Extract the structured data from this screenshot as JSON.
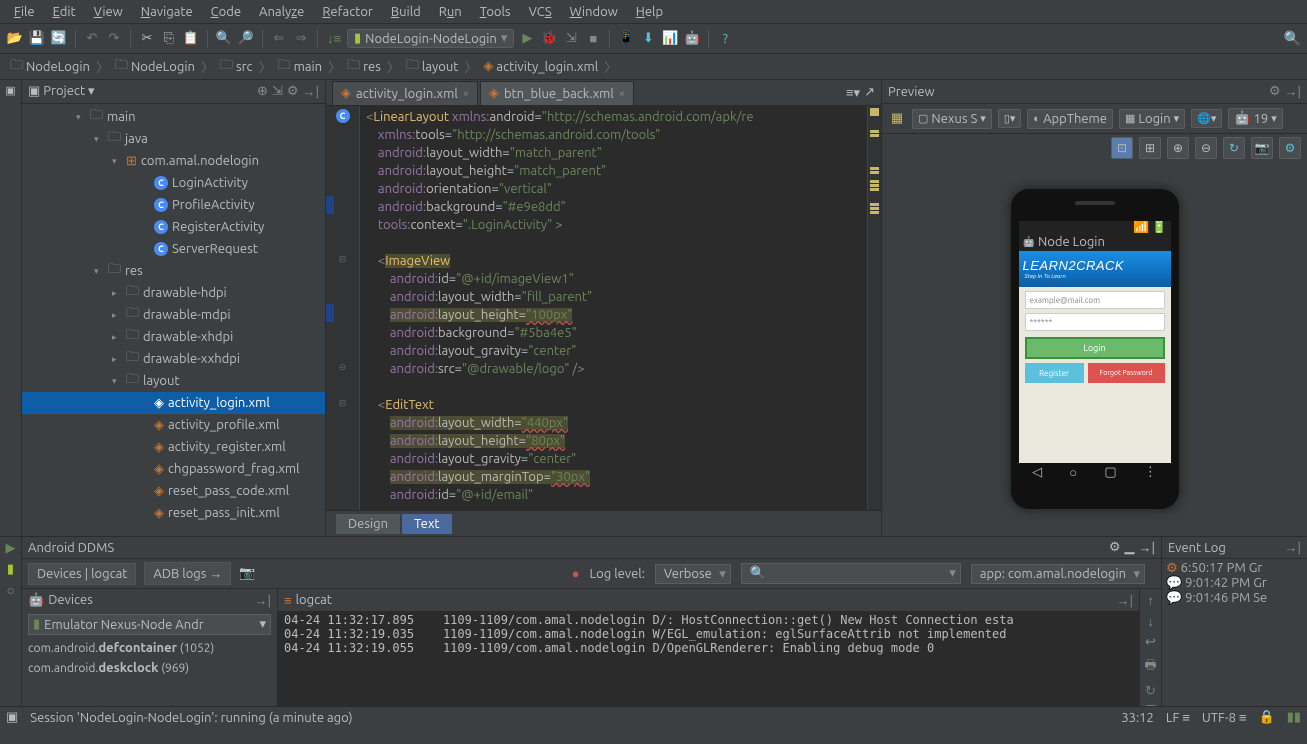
{
  "menu": [
    "File",
    "Edit",
    "View",
    "Navigate",
    "Code",
    "Analyze",
    "Refactor",
    "Build",
    "Run",
    "Tools",
    "VCS",
    "Window",
    "Help"
  ],
  "runConfig": "NodeLogin-NodeLogin",
  "breadcrumb": [
    {
      "icon": "folder",
      "label": "NodeLogin"
    },
    {
      "icon": "folder",
      "label": "NodeLogin"
    },
    {
      "icon": "folder",
      "label": "src"
    },
    {
      "icon": "folder",
      "label": "main"
    },
    {
      "icon": "folder",
      "label": "res"
    },
    {
      "icon": "folder",
      "label": "layout"
    },
    {
      "icon": "xml",
      "label": "activity_login.xml"
    }
  ],
  "projectPanel": {
    "title": "Project"
  },
  "tree": [
    {
      "ind": 54,
      "arrow": "▾",
      "icon": "folder",
      "label": "main"
    },
    {
      "ind": 72,
      "arrow": "▾",
      "icon": "folder",
      "label": "java"
    },
    {
      "ind": 90,
      "arrow": "▾",
      "icon": "pkg",
      "label": "com.amal.nodelogin"
    },
    {
      "ind": 118,
      "icon": "cls",
      "label": "LoginActivity"
    },
    {
      "ind": 118,
      "icon": "cls",
      "label": "ProfileActivity"
    },
    {
      "ind": 118,
      "icon": "cls",
      "label": "RegisterActivity"
    },
    {
      "ind": 118,
      "icon": "cls",
      "label": "ServerRequest"
    },
    {
      "ind": 72,
      "arrow": "▾",
      "icon": "folder-res",
      "label": "res"
    },
    {
      "ind": 90,
      "arrow": "▸",
      "icon": "folder",
      "label": "drawable-hdpi"
    },
    {
      "ind": 90,
      "arrow": "▸",
      "icon": "folder",
      "label": "drawable-mdpi"
    },
    {
      "ind": 90,
      "arrow": "▸",
      "icon": "folder",
      "label": "drawable-xhdpi"
    },
    {
      "ind": 90,
      "arrow": "▸",
      "icon": "folder",
      "label": "drawable-xxhdpi"
    },
    {
      "ind": 90,
      "arrow": "▾",
      "icon": "folder",
      "label": "layout"
    },
    {
      "ind": 118,
      "icon": "xml",
      "label": "activity_login.xml",
      "sel": true
    },
    {
      "ind": 118,
      "icon": "xml",
      "label": "activity_profile.xml"
    },
    {
      "ind": 118,
      "icon": "xml",
      "label": "activity_register.xml"
    },
    {
      "ind": 118,
      "icon": "xml",
      "label": "chgpassword_frag.xml"
    },
    {
      "ind": 118,
      "icon": "xml",
      "label": "reset_pass_code.xml"
    },
    {
      "ind": 118,
      "icon": "xml",
      "label": "reset_pass_init.xml"
    }
  ],
  "editorTabs": [
    {
      "label": "activity_login.xml",
      "active": true
    },
    {
      "label": "btn_blue_back.xml",
      "active": false
    }
  ],
  "bottomTabs": {
    "design": "Design",
    "text": "Text"
  },
  "preview": {
    "title": "Preview",
    "device": "Nexus S",
    "theme": "AppTheme",
    "activity": "Login",
    "api": "19",
    "appTitle": "Node Login",
    "logo": "LEARN2CRACK",
    "logoSub": "Step In To Learn",
    "email": "example@mail.com",
    "password": "******",
    "login": "Login",
    "register": "Register",
    "forgot": "Forgot Password"
  },
  "ddms": {
    "title": "Android DDMS",
    "tab1": "Devices | logcat",
    "tab2": "ADB logs",
    "devicesTitle": "Devices",
    "emulator": "Emulator Nexus-Node Andr",
    "proc1": "com.android.defcontainer (1052)",
    "proc2": "com.android.deskclock (969)",
    "logcatTitle": "logcat",
    "loglevelLabel": "Log level:",
    "loglevel": "Verbose",
    "filter": "app: com.amal.nodelogin",
    "lines": [
      "04-24 11:32:17.895    1109-1109/com.amal.nodelogin D/: HostConnection::get() New Host Connection esta",
      "04-24 11:32:19.035    1109-1109/com.amal.nodelogin W/EGL_emulation: eglSurfaceAttrib not implemented",
      "04-24 11:32:19.055    1109-1109/com.amal.nodelogin D/OpenGLRenderer: Enabling debug mode 0"
    ]
  },
  "eventLog": {
    "title": "Event Log",
    "lines": [
      "6:50:17 PM Gr",
      "9:01:42 PM Gr",
      "9:01:46 PM Se"
    ]
  },
  "status": {
    "msg": "Session 'NodeLogin-NodeLogin': running (a minute ago)",
    "pos": "33:12",
    "lf": "LF",
    "enc": "UTF-8"
  }
}
